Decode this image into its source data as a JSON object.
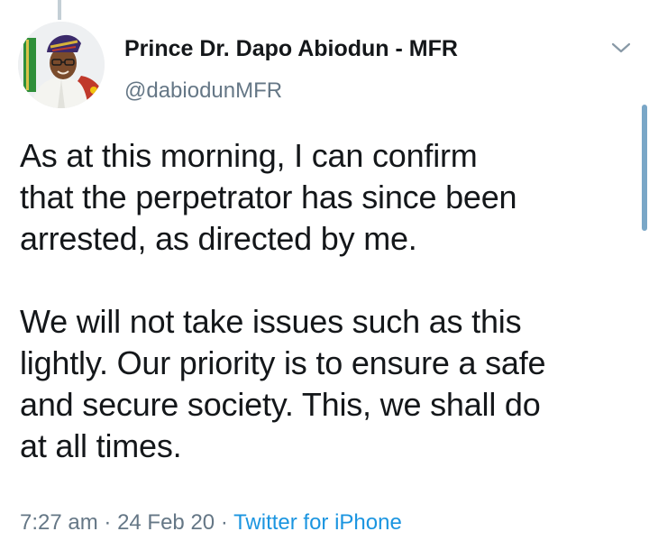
{
  "tweet": {
    "author": {
      "display_name": "Prince Dr. Dapo Abiodun - MFR",
      "handle": "@dabiodunMFR",
      "avatar": "profile-photo"
    },
    "text": "As at this morning, I can confirm\nthat the perpetrator has since been\narrested, as directed by me.\n\nWe will not take issues such as this\nlightly. Our priority is to ensure a safe\nand secure society. This, we shall do\nat all times.",
    "time": "7:27 am",
    "separator": "·",
    "date": "24 Feb 20",
    "source": "Twitter for iPhone",
    "menu_icon": "chevron-down-icon"
  },
  "colors": {
    "text": "#14171a",
    "muted": "#657786",
    "link": "#1b95e0",
    "thread_line": "#c4cfd6"
  }
}
